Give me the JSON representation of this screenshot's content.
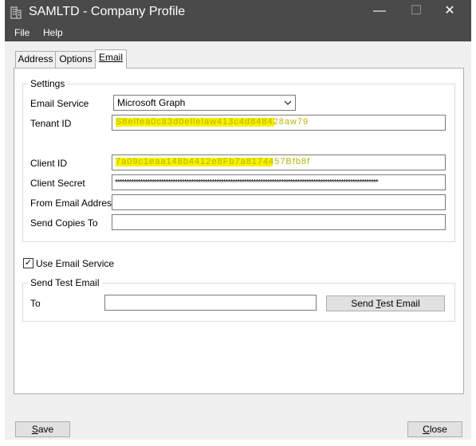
{
  "window": {
    "title": "SAMLTD - Company Profile",
    "controls": {
      "minimize": "—",
      "maximize": "☐",
      "close": "✕"
    }
  },
  "menu": [
    {
      "label": "File"
    },
    {
      "label": "Help"
    }
  ],
  "tabs": [
    {
      "label": "Address",
      "active": false
    },
    {
      "label": "Options",
      "active": false
    },
    {
      "label": "Email",
      "active": true
    }
  ],
  "settings": {
    "legend": "Settings",
    "email_service_label": "Email Service",
    "email_service_value": "Microsoft Graph",
    "tenant_id_label": "Tenant ID",
    "tenant_id_value": "S8elfea0c83d0ellelaw413c4d848428aw79",
    "client_id_label": "Client ID",
    "client_id_value": "7a09c1eaa148b4412e8Fb7a8174457Bfb8f",
    "client_secret_label": "Client Secret",
    "client_secret_value": "******************************************************************************************************************",
    "from_email_label": "From Email Address",
    "from_email_value": "",
    "send_copies_label": "Send Copies To",
    "send_copies_value": ""
  },
  "use_email_service": {
    "label": "Use Email Service",
    "checked": true,
    "mark": "✓"
  },
  "send_test": {
    "legend": "Send Test Email",
    "to_label": "To",
    "to_value": "",
    "button_prefix": "Send ",
    "button_mnemonic": "T",
    "button_suffix": "est Email"
  },
  "footer": {
    "save_mnemonic": "S",
    "save_rest": "ave",
    "close_mnemonic": "C",
    "close_rest": "lose"
  },
  "colors": {
    "titlebar": "#4a4a4a",
    "highlight": "#f8f000",
    "dialog_bg": "#f0f0f0"
  }
}
